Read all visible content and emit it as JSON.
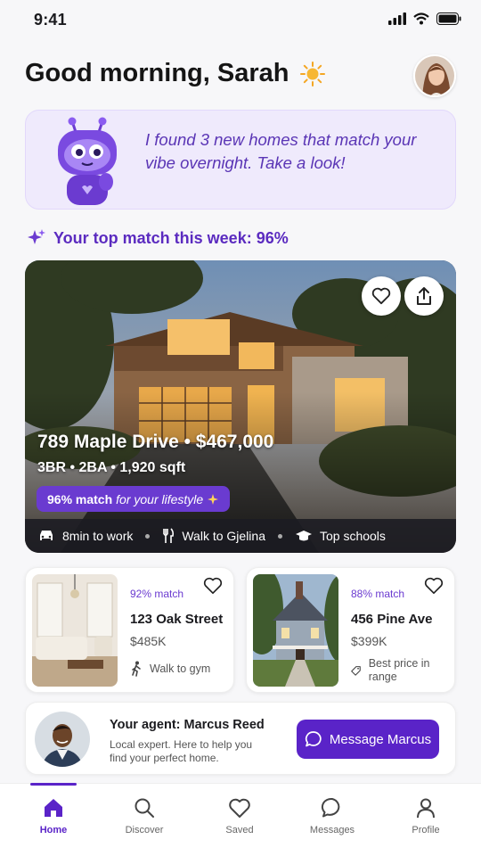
{
  "status_bar": {
    "time": "9:41"
  },
  "header": {
    "greeting": "Good morning, Sarah"
  },
  "assistant": {
    "message": "I found 3 new homes that match your vibe overnight. Take a look!"
  },
  "top_match": {
    "heading": "Your top match this week: 96%",
    "match_percent": 96
  },
  "featured": {
    "title": "789 Maple Drive • $467,000",
    "details": "3BR • 2BA • 1,920 sqft",
    "match_strong": "96% match",
    "match_rest": "for your lifestyle",
    "perks": [
      "8min to work",
      "Walk to Gjelina",
      "Top schools"
    ]
  },
  "listings": [
    {
      "match": "92% match",
      "address": "123 Oak Street",
      "price": "$485K",
      "perk": "Walk to gym"
    },
    {
      "match": "88% match",
      "address": "456 Pine Ave",
      "price": "$399K",
      "perk": "Best price in range"
    }
  ],
  "agent": {
    "title": "Your agent: Marcus Reed",
    "description": "Local expert. Here to help you find your perfect home.",
    "button_label": "Message Marcus"
  },
  "tabs": [
    {
      "label": "Home",
      "icon": "home-icon",
      "active": true
    },
    {
      "label": "Discover",
      "icon": "search-icon",
      "active": false
    },
    {
      "label": "Saved",
      "icon": "heart-icon",
      "active": false
    },
    {
      "label": "Messages",
      "icon": "chat-icon",
      "active": false
    },
    {
      "label": "Profile",
      "icon": "user-icon",
      "active": false
    }
  ],
  "colors": {
    "accent": "#5a23c8",
    "accent_text": "#5b2bc0",
    "assistant_bg": "#efeafc"
  }
}
